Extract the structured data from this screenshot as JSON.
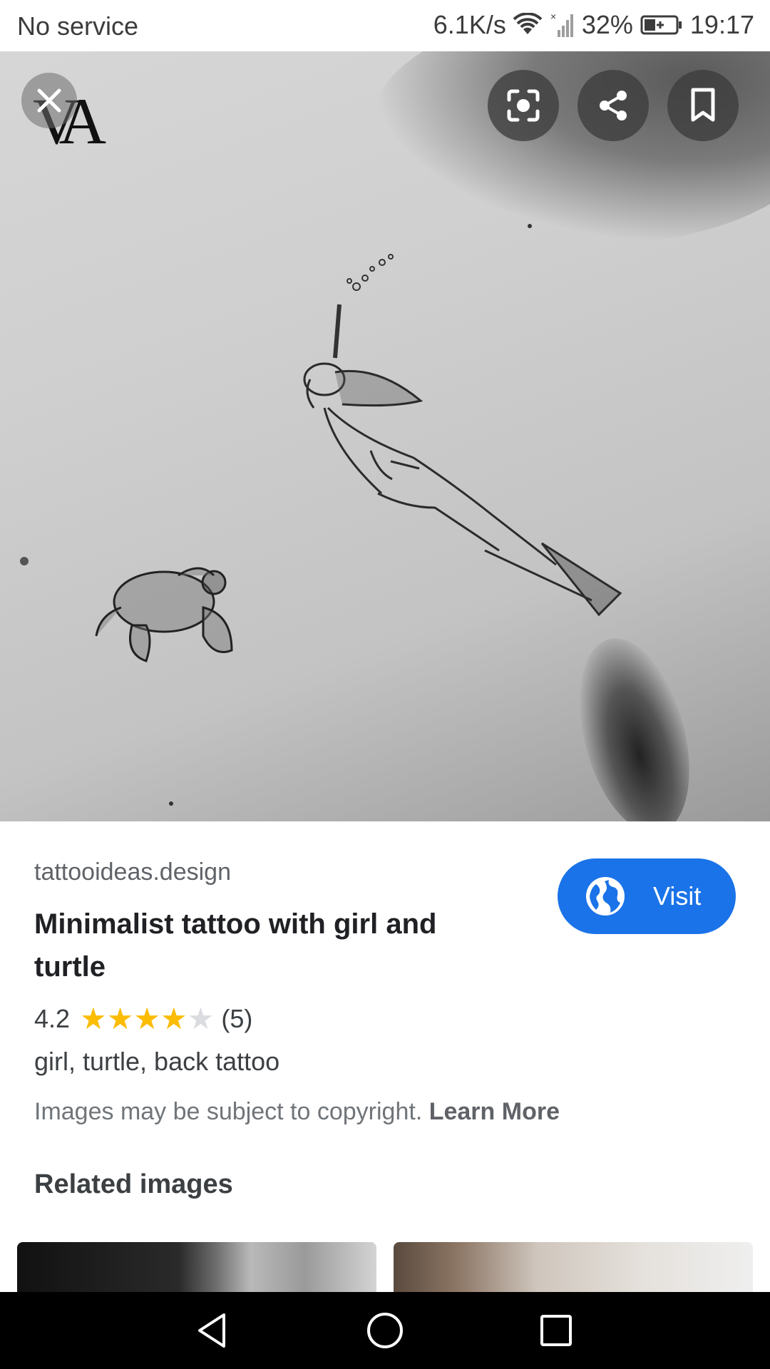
{
  "status_bar": {
    "carrier": "No service",
    "speed": "6.1K/s",
    "battery_pct": "32%",
    "time": "19:17"
  },
  "image_viewer": {
    "logo_text": "VA"
  },
  "result": {
    "source": "tattooideas.design",
    "title": "Minimalist tattoo with girl and turtle",
    "visit_label": "Visit",
    "rating_value": "4.2",
    "rating_stars": 4,
    "rating_count": "(5)",
    "tags": "girl, turtle, back tattoo",
    "copyright_text": "Images may be subject to copyright.",
    "learn_more": "Learn More"
  },
  "related": {
    "heading": "Related images"
  },
  "icons": {
    "close": "close-icon",
    "lens": "lens-icon",
    "share": "share-icon",
    "bookmark": "bookmark-icon",
    "globe": "globe-icon",
    "back": "back-triangle-icon",
    "home": "home-circle-icon",
    "recents": "recents-square-icon"
  },
  "colors": {
    "accent": "#1a73e8",
    "star": "#fbbc04"
  }
}
